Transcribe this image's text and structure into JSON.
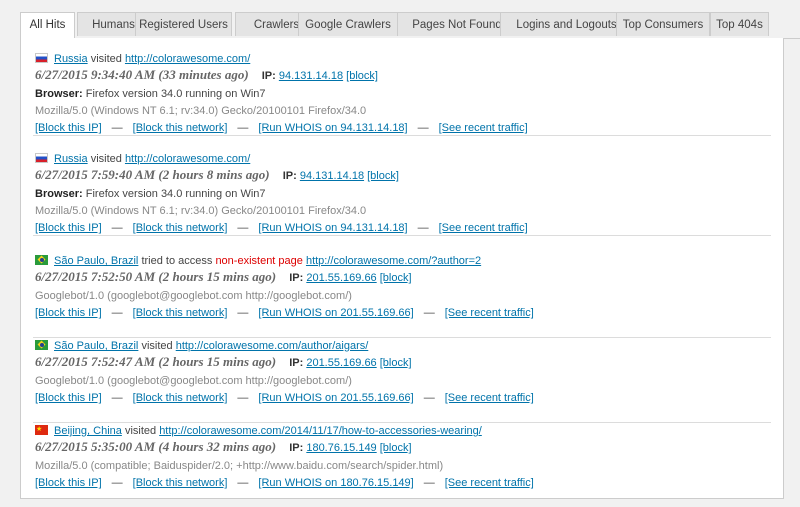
{
  "tabs": [
    "All Hits",
    "Humans",
    "Registered Users",
    "Crawlers",
    "Google Crawlers",
    "Pages Not Found",
    "Logins and Logouts",
    "Top Consumers",
    "Top 404s"
  ],
  "active_tab": "All Hits",
  "labels": {
    "visited": "visited",
    "tried": "tried to access",
    "nonexistent": "non-existent page",
    "ip": "IP:",
    "block": "[block]",
    "browser": "Browser:",
    "block_ip": "[Block this IP]",
    "block_network": "[Block this network]",
    "see_traffic": "[See recent traffic]",
    "dash": "—"
  },
  "colors": {
    "link": "#0073aa",
    "error": "#dd0000",
    "timestamp": "#666666"
  },
  "hits": [
    {
      "flag": "russia-flag",
      "location": "Russia",
      "url": "http://colorawesome.com/",
      "time": "6/27/2015 9:34:40 AM (33 minutes ago)",
      "ip": "94.131.14.18",
      "browser": "Firefox version 34.0 running on Win7",
      "ua": "Mozilla/5.0 (Windows NT 6.1; rv:34.0) Gecko/20100101 Firefox/34.0",
      "whois": "[Run WHOIS on 94.131.14.18]"
    },
    {
      "flag": "russia-flag",
      "location": "Russia",
      "url": "http://colorawesome.com/",
      "time": "6/27/2015 7:59:40 AM (2 hours 8 mins ago)",
      "ip": "94.131.14.18",
      "browser": "Firefox version 34.0 running on Win7",
      "ua": "Mozilla/5.0 (Windows NT 6.1; rv:34.0) Gecko/20100101 Firefox/34.0",
      "whois": "[Run WHOIS on 94.131.14.18]"
    },
    {
      "flag": "brazil-flag",
      "location": "São Paulo, Brazil",
      "url": "http://colorawesome.com/?author=2",
      "time": "6/27/2015 7:52:50 AM (2 hours 15 mins ago)",
      "ip": "201.55.169.66",
      "ua": "Googlebot/1.0 (googlebot@googlebot.com http://googlebot.com/)",
      "whois": "[Run WHOIS on 201.55.169.66]"
    },
    {
      "flag": "brazil-flag",
      "location": "São Paulo, Brazil",
      "url": "http://colorawesome.com/author/aigars/",
      "time": "6/27/2015 7:52:47 AM (2 hours 15 mins ago)",
      "ip": "201.55.169.66",
      "ua": "Googlebot/1.0 (googlebot@googlebot.com http://googlebot.com/)",
      "whois": "[Run WHOIS on 201.55.169.66]"
    },
    {
      "flag": "china-flag",
      "location": "Beijing, China",
      "url": "http://colorawesome.com/2014/11/17/how-to-accessories-wearing/",
      "time": "6/27/2015 5:35:00 AM (4 hours 32 mins ago)",
      "ip": "180.76.15.149",
      "ua": "Mozilla/5.0 (compatible; Baiduspider/2.0; +http://www.baidu.com/search/spider.html)",
      "whois": "[Run WHOIS on 180.76.15.149]"
    }
  ]
}
